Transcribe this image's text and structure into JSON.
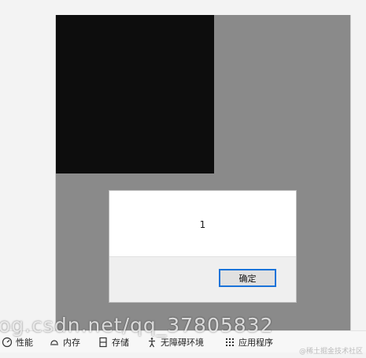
{
  "dialog": {
    "message": "1",
    "ok_label": "确定"
  },
  "toolbar": {
    "items": [
      {
        "label": "性能",
        "icon": "performance-icon"
      },
      {
        "label": "内存",
        "icon": "memory-icon"
      },
      {
        "label": "存储",
        "icon": "storage-icon"
      },
      {
        "label": "无障碍环境",
        "icon": "accessibility-icon"
      },
      {
        "label": "应用程序",
        "icon": "application-icon"
      }
    ]
  },
  "watermark": {
    "url_text": "og.csdn.net/qq_37805832",
    "credit": "@稀土掘金技术社区"
  },
  "colors": {
    "page_background": "#8a8a8a",
    "black_square": "#0d0d0d",
    "dialog_background": "#ffffff",
    "dialog_footer": "#efefef",
    "button_focus_border": "#1a73d9"
  }
}
